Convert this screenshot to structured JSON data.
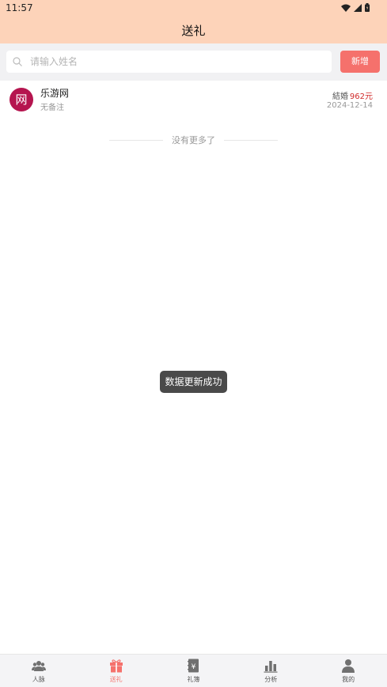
{
  "status_bar": {
    "time": "11:57"
  },
  "header": {
    "title": "送礼"
  },
  "search": {
    "placeholder": "请输入姓名",
    "add_label": "新增"
  },
  "records": [
    {
      "avatar_char": "网",
      "name": "乐游网",
      "note": "无备注",
      "type": "結婚",
      "amount": "962元",
      "date": "2024-12-14"
    }
  ],
  "list_footer": "没有更多了",
  "toast": "数据更新成功",
  "tabbar": {
    "items": [
      {
        "label": "人脉",
        "icon": "people-icon",
        "active": false
      },
      {
        "label": "送礼",
        "icon": "gift-icon",
        "active": true
      },
      {
        "label": "礼簿",
        "icon": "ledger-icon",
        "active": false
      },
      {
        "label": "分析",
        "icon": "bar-chart-icon",
        "active": false
      },
      {
        "label": "我的",
        "icon": "person-icon",
        "active": false
      }
    ]
  },
  "colors": {
    "header_bg": "#fdd3b9",
    "accent": "#f5716c",
    "avatar_bg": "#b5154f",
    "amount": "#d12b2b"
  }
}
